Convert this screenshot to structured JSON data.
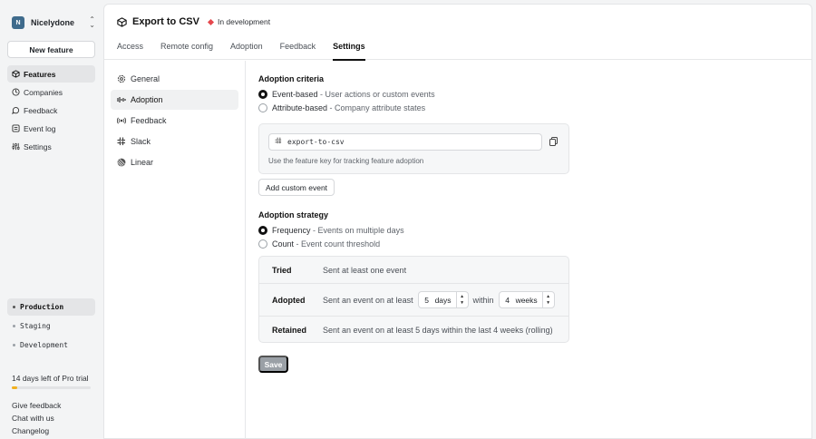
{
  "org": {
    "avatar_letter": "N",
    "name": "Nicelydone"
  },
  "sidebar": {
    "new_feature_label": "New feature",
    "items": [
      {
        "label": "Features",
        "icon": "box-icon",
        "active": true
      },
      {
        "label": "Companies",
        "icon": "companies-icon",
        "active": false
      },
      {
        "label": "Feedback",
        "icon": "feedback-icon",
        "active": false
      },
      {
        "label": "Event log",
        "icon": "list-icon",
        "active": false
      },
      {
        "label": "Settings",
        "icon": "sliders-icon",
        "active": false
      }
    ],
    "environments": [
      {
        "label": "Production",
        "active": true
      },
      {
        "label": "Staging",
        "active": false
      },
      {
        "label": "Development",
        "active": false
      }
    ],
    "trial_text": "14 days left of Pro trial",
    "trial_progress": 0.07,
    "trial_color": "#f2b01e",
    "footer_links": [
      "Give feedback",
      "Chat with us",
      "Changelog"
    ]
  },
  "header": {
    "title": "Export to CSV",
    "status": "In development",
    "status_color": "#e5484d",
    "tabs": [
      {
        "label": "Access",
        "active": false
      },
      {
        "label": "Remote config",
        "active": false
      },
      {
        "label": "Adoption",
        "active": false
      },
      {
        "label": "Feedback",
        "active": false
      },
      {
        "label": "Settings",
        "active": true
      }
    ]
  },
  "settings_nav": [
    {
      "label": "General",
      "icon": "gear-icon",
      "active": false
    },
    {
      "label": "Adoption",
      "icon": "adoption-icon",
      "active": true
    },
    {
      "label": "Feedback",
      "icon": "feedback-wave-icon",
      "active": false
    },
    {
      "label": "Slack",
      "icon": "slack-icon",
      "active": false
    },
    {
      "label": "Linear",
      "icon": "linear-icon",
      "active": false
    }
  ],
  "adoption_criteria": {
    "title": "Adoption criteria",
    "options": [
      {
        "name": "Event-based",
        "desc": "User actions or custom events",
        "selected": true
      },
      {
        "name": "Attribute-based",
        "desc": "Company attribute states",
        "selected": false
      }
    ],
    "feature_key": "export-to-csv",
    "feature_key_help": "Use the feature key for tracking feature adoption",
    "add_custom_event_label": "Add custom event"
  },
  "adoption_strategy": {
    "title": "Adoption strategy",
    "options": [
      {
        "name": "Frequency",
        "desc": "Events on multiple days",
        "selected": true
      },
      {
        "name": "Count",
        "desc": "Event count threshold",
        "selected": false
      }
    ],
    "rows": {
      "tried": {
        "label": "Tried",
        "text": "Sent at least one event"
      },
      "adopted": {
        "label": "Adopted",
        "text_before": "Sent an event on at least",
        "days_value": "5",
        "days_unit": "days",
        "within": "within",
        "weeks_value": "4",
        "weeks_unit": "weeks"
      },
      "retained": {
        "label": "Retained",
        "text": "Sent an event on at least 5 days within the last 4 weeks (rolling)"
      }
    }
  },
  "save_label": "Save"
}
